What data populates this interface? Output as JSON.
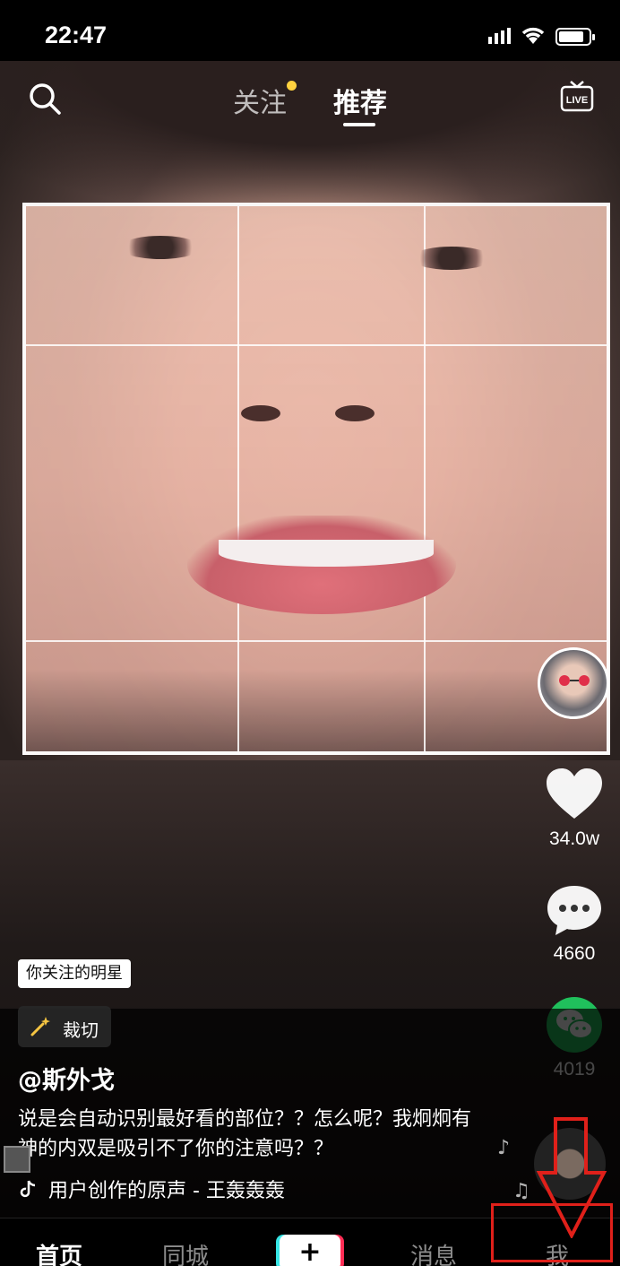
{
  "status_bar": {
    "time": "22:47",
    "battery_level": 0.85
  },
  "top_nav": {
    "tabs": [
      {
        "label": "关注",
        "active": false,
        "has_dot": true
      },
      {
        "label": "推荐",
        "active": true
      }
    ],
    "search_icon": "search-icon",
    "live_icon": "live-icon",
    "live_label": "LIVE"
  },
  "video": {
    "star_tag": "你关注的明星",
    "effect_label": "裁切",
    "author": "@斯外戈",
    "caption": "说是会自动识别最好看的部位？？怎么呢？我炯炯有神的内双是吸引不了你的注意吗？？",
    "music": "用户创作的原声 - 王轰轰轰"
  },
  "actions": {
    "likes": "34.0w",
    "comments": "4660",
    "shares": "4019"
  },
  "bottom_tabs": {
    "home": "首页",
    "city": "同城",
    "create": "+",
    "messages": "消息",
    "me": "我"
  },
  "colors": {
    "accent_follow_dot": "#ffd23f",
    "share_green": "#20c05c",
    "annotation_red": "#e0201a"
  }
}
